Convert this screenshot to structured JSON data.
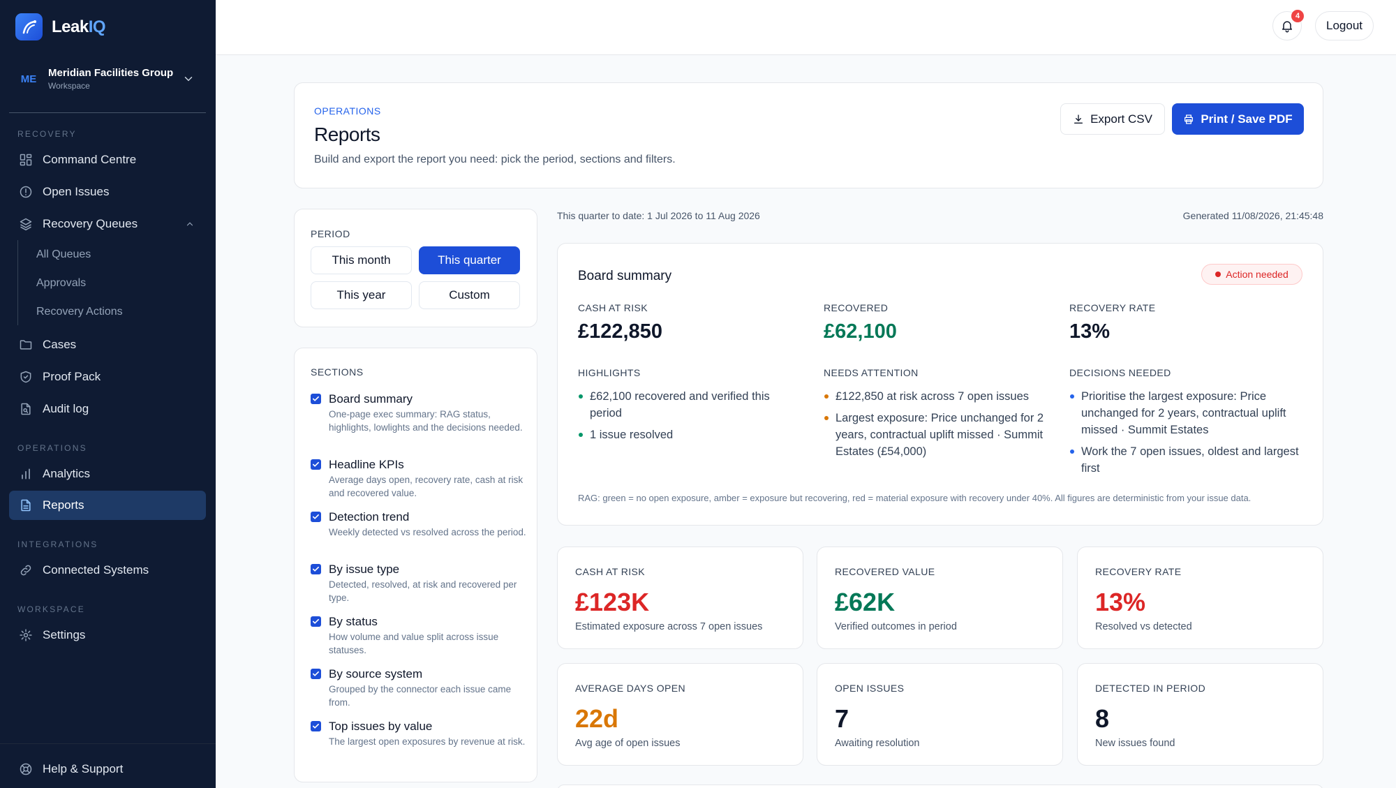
{
  "app": {
    "name_main": "Leak",
    "name_accent": "IQ"
  },
  "workspace": {
    "initials": "ME",
    "name": "Meridian Facilities Group",
    "subtitle": "Workspace"
  },
  "sidebar": {
    "sections": {
      "recovery": "RECOVERY",
      "operations": "OPERATIONS",
      "integrations": "INTEGRATIONS",
      "workspace": "WORKSPACE"
    },
    "items": {
      "command_centre": "Command Centre",
      "open_issues": "Open Issues",
      "recovery_queues": "Recovery Queues",
      "all_queues": "All Queues",
      "approvals": "Approvals",
      "recovery_actions": "Recovery Actions",
      "cases": "Cases",
      "proof_pack": "Proof Pack",
      "audit_log": "Audit log",
      "analytics": "Analytics",
      "reports": "Reports",
      "connected_systems": "Connected Systems",
      "settings": "Settings",
      "help": "Help & Support"
    }
  },
  "topbar": {
    "notifications": "4",
    "logout": "Logout"
  },
  "header": {
    "eyebrow": "OPERATIONS",
    "title": "Reports",
    "description": "Build and export the report you need: pick the period, sections and filters.",
    "export_csv": "Export CSV",
    "print_pdf": "Print / Save PDF"
  },
  "period": {
    "label": "PERIOD",
    "options": [
      "This month",
      "This quarter",
      "This year",
      "Custom"
    ],
    "selected": "This quarter"
  },
  "sections": {
    "label": "SECTIONS",
    "items": [
      {
        "title": "Board summary",
        "desc": "One-page exec summary: RAG status, highlights, lowlights and the decisions needed.",
        "checked": true
      },
      {
        "title": "Headline KPIs",
        "desc": "Average days open, recovery rate, cash at risk and recovered value.",
        "checked": true
      },
      {
        "title": "Detection trend",
        "desc": "Weekly detected vs resolved across the period.",
        "checked": true
      },
      {
        "title": "By issue type",
        "desc": "Detected, resolved, at risk and recovered per type.",
        "checked": true
      },
      {
        "title": "By status",
        "desc": "How volume and value split across issue statuses.",
        "checked": true
      },
      {
        "title": "By source system",
        "desc": "Grouped by the connector each issue came from.",
        "checked": true
      },
      {
        "title": "Top issues by value",
        "desc": "The largest open exposures by revenue at risk.",
        "checked": true
      }
    ]
  },
  "report_meta": {
    "range": "This quarter to date: 1 Jul 2026 to 11 Aug 2026",
    "generated": "Generated 11/08/2026, 21:45:48"
  },
  "board": {
    "title": "Board summary",
    "status": "Action needed",
    "status_color": "#dc2626",
    "metrics": {
      "cash_label": "CASH AT RISK",
      "cash_value": "£122,850",
      "recovered_label": "RECOVERED",
      "recovered_value": "£62,100",
      "rate_label": "RECOVERY RATE",
      "rate_value": "13%"
    },
    "highlights_label": "HIGHLIGHTS",
    "highlights": [
      "£62,100 recovered and verified this period",
      "1 issue resolved"
    ],
    "attention_label": "NEEDS ATTENTION",
    "attention": [
      "£122,850 at risk across 7 open issues",
      "Largest exposure: Price unchanged for 2 years, contractual uplift missed · Summit Estates (£54,000)"
    ],
    "decisions_label": "DECISIONS NEEDED",
    "decisions": [
      "Prioritise the largest exposure: Price unchanged for 2 years, contractual uplift missed · Summit Estates",
      "Work the 7 open issues, oldest and largest first"
    ],
    "rag_note": "RAG: green = no open exposure, amber = exposure but recovering, red = material exposure with recovery under 40%. All figures are deterministic from your issue data."
  },
  "kpis": [
    {
      "label": "CASH AT RISK",
      "value": "£123K",
      "sub": "Estimated exposure across 7 open issues",
      "color": "#dc2626"
    },
    {
      "label": "RECOVERED VALUE",
      "value": "£62K",
      "sub": "Verified outcomes in period",
      "color": "#047857"
    },
    {
      "label": "RECOVERY RATE",
      "value": "13%",
      "sub": "Resolved vs detected",
      "color": "#dc2626"
    },
    {
      "label": "AVERAGE DAYS OPEN",
      "value": "22d",
      "sub": "Avg age of open issues",
      "color": "#d97706"
    },
    {
      "label": "OPEN ISSUES",
      "value": "7",
      "sub": "Awaiting resolution",
      "color": "#0f172a"
    },
    {
      "label": "DETECTED IN PERIOD",
      "value": "8",
      "sub": "New issues found",
      "color": "#0f172a"
    }
  ]
}
